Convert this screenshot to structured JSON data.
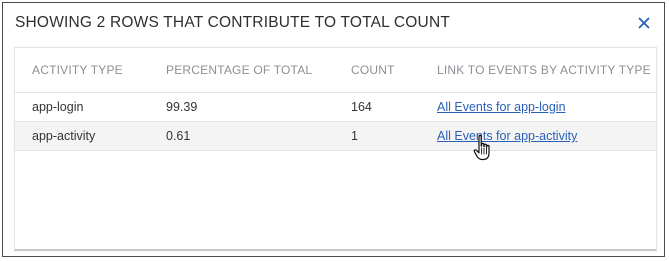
{
  "dialog": {
    "title": "SHOWING 2 ROWS THAT CONTRIBUTE TO TOTAL COUNT",
    "close_icon": "close-icon"
  },
  "table": {
    "columns": [
      "ACTIVITY TYPE",
      "PERCENTAGE OF TOTAL",
      "COUNT",
      "LINK TO EVENTS BY ACTIVITY TYPE"
    ],
    "rows": [
      {
        "activity_type": "app-login",
        "percentage": "99.39",
        "count": "164",
        "link": "All Events for app-login"
      },
      {
        "activity_type": "app-activity",
        "percentage": "0.61",
        "count": "1",
        "link": "All Events for app-activity"
      }
    ]
  },
  "colors": {
    "link": "#2a61b8",
    "close_icon": "#2a61b8",
    "header_text": "#8c8f94",
    "alt_row": "#f4f4f4"
  },
  "cursor_icon": "hand-pointer-icon"
}
